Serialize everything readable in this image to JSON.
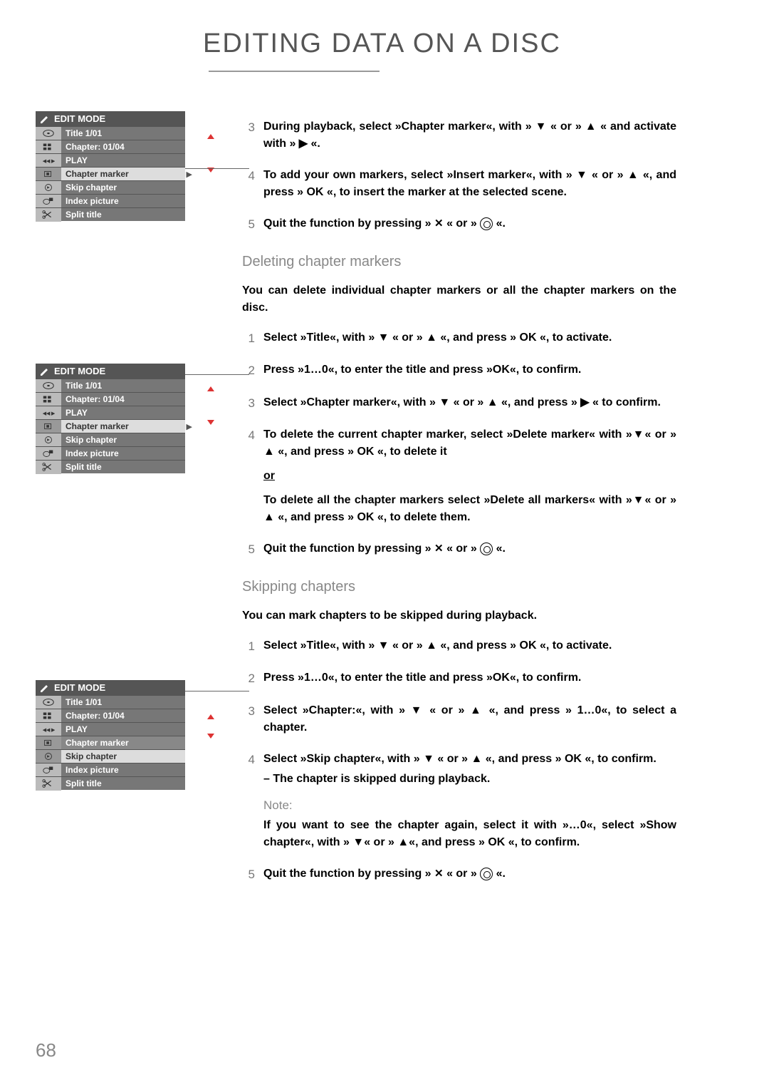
{
  "page": {
    "title": "EDITING DATA ON A DISC",
    "number": "68"
  },
  "menus": {
    "header": "EDIT MODE",
    "rows": {
      "title": "Title 1/01",
      "chapter": "Chapter: 01/04",
      "play": "PLAY",
      "chapter_marker": "Chapter marker",
      "skip_chapter": "Skip chapter",
      "index_picture": "Index picture",
      "split_title": "Split title"
    }
  },
  "sectionA": {
    "steps": {
      "s3": "During playback, select »Chapter marker«, with » ▼ « or » ▲ « and activate with » ▶ «.",
      "s4": "To add your own markers, select »Insert marker«, with » ▼ « or » ▲ «, and press » OK «, to insert the marker at the selected scene.",
      "s5_a": "Quit the function by pressing »",
      "s5_b": "« or »",
      "s5_c": "«."
    }
  },
  "sectionB": {
    "heading": "Deleting chapter markers",
    "intro": "You can delete individual chapter markers or all the chapter markers on the disc.",
    "steps": {
      "s1": "Select »Title«, with » ▼ « or » ▲ «, and press » OK «, to activate.",
      "s2": "Press »1…0«, to enter the title and press »OK«, to confirm.",
      "s3": "Select »Chapter marker«, with » ▼ « or » ▲ «, and press » ▶ « to confirm.",
      "s4a": "To delete the current chapter marker, select »Delete marker« with »▼« or » ▲ «, and press » OK «, to delete it",
      "or": "or",
      "s4b": "To delete all the chapter markers select »Delete all markers« with »▼« or » ▲ «, and press » OK «, to delete them.",
      "s5_a": "Quit the function by pressing »",
      "s5_b": "« or »",
      "s5_c": "«."
    }
  },
  "sectionC": {
    "heading": "Skipping chapters",
    "intro": "You can mark chapters to be skipped during playback.",
    "steps": {
      "s1": "Select »Title«, with » ▼ « or » ▲ «, and press » OK «, to activate.",
      "s2": "Press »1…0«, to enter the title and press »OK«, to confirm.",
      "s3": "Select »Chapter:«, with » ▼ « or » ▲ «, and press » 1…0«, to select a chapter.",
      "s4a": "Select »Skip chapter«, with » ▼ « or » ▲ «, and press » OK «, to confirm.",
      "s4b": "– The chapter is skipped during playback.",
      "note_h": "Note:",
      "note": "If you want to see the chapter again, select it with »…0«, select »Show chapter«, with » ▼« or » ▲«, and press » OK «, to confirm.",
      "s5_a": "Quit the function by pressing »",
      "s5_b": "« or »",
      "s5_c": "«."
    }
  }
}
